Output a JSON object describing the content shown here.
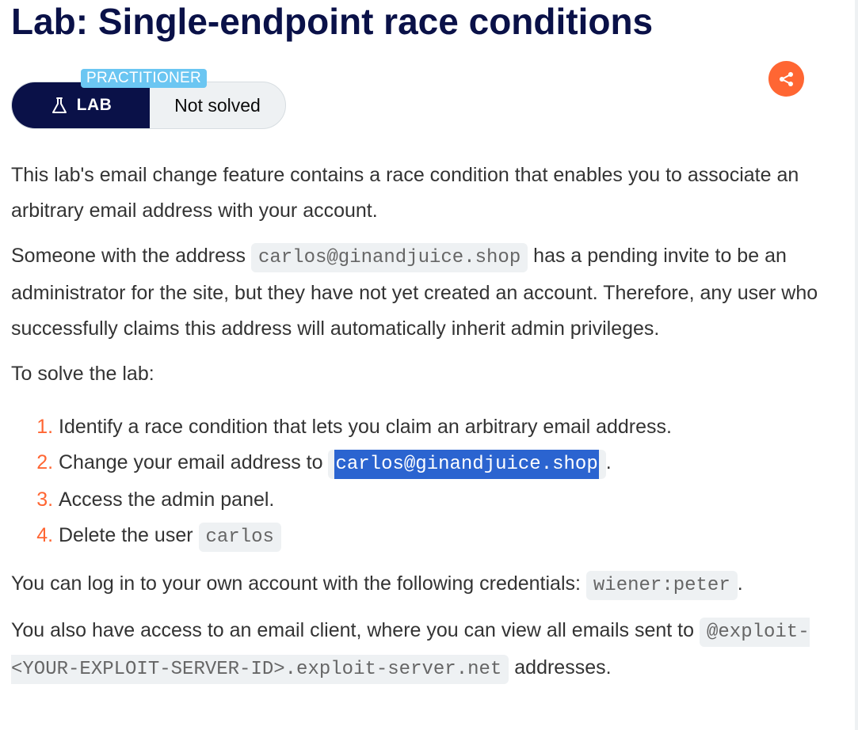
{
  "title": "Lab: Single-endpoint race conditions",
  "lab": {
    "level": "PRACTITIONER",
    "badge_label": "LAB",
    "status": "Not solved"
  },
  "share": {
    "icon": "share-icon",
    "color": "#ff6633"
  },
  "colors": {
    "title": "#0a1148",
    "accent": "#ff6633",
    "level_tag": "#6bc6f2",
    "selection": "#2b64d0"
  },
  "description": {
    "p1": "This lab's email change feature contains a race condition that enables you to associate an arbitrary email address with your account.",
    "p2_before": "Someone with the address ",
    "p2_code": "carlos@ginandjuice.shop",
    "p2_after": " has a pending invite to be an administrator for the site, but they have not yet created an account. Therefore, any user who successfully claims this address will automatically inherit admin privileges.",
    "p3": "To solve the lab:",
    "steps": [
      {
        "text": "Identify a race condition that lets you claim an arbitrary email address."
      },
      {
        "text": "Change your email address to ",
        "code": "carlos@ginandjuice.shop",
        "after": "."
      },
      {
        "text": "Access the admin panel."
      },
      {
        "text": "Delete the user ",
        "code": "carlos"
      }
    ],
    "p4_before": "You can log in to your own account with the following credentials: ",
    "p4_code": "wiener:peter",
    "p4_after": ".",
    "p5_before": "You also have access to an email client, where you can view all emails sent to ",
    "p5_code": "@exploit-<YOUR-EXPLOIT-SERVER-ID>.exploit-server.net",
    "p5_after": " addresses."
  }
}
